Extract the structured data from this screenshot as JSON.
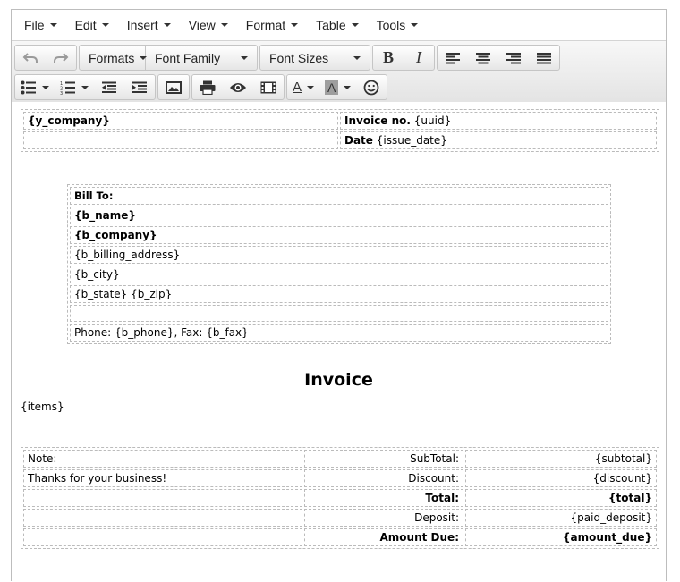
{
  "menu": [
    "File",
    "Edit",
    "Insert",
    "View",
    "Format",
    "Table",
    "Tools"
  ],
  "toolbar": {
    "formats": "Formats",
    "font_family": "Font Family",
    "font_sizes": "Font Sizes",
    "bold": "B",
    "italic": "I",
    "text_color_glyph": "A",
    "bg_color_glyph": "A",
    "bg_color": "#9e9e9e"
  },
  "doc": {
    "company": "{y_company}",
    "invoice_no_label": "Invoice no.",
    "invoice_no_value": " {uuid}",
    "date_label": "Date",
    "date_value": " {issue_date}",
    "bill_to": "Bill To:",
    "b_name": "{b_name}",
    "b_company": "{b_company}",
    "b_billing_address": "{b_billing_address}",
    "b_city": "{b_city}",
    "b_state_zip": "{b_state} {b_zip}",
    "phone_fax": "Phone: {b_phone}, Fax: {b_fax}",
    "title": "Invoice",
    "items": "{items}",
    "note_label": "Note:",
    "thanks": "Thanks for your business!",
    "subtotal_label": "SubTotal:",
    "subtotal_value": "{subtotal}",
    "discount_label": "Discount:",
    "discount_value": "{discount}",
    "total_label": "Total:",
    "total_value": "{total}",
    "deposit_label": "Deposit:",
    "deposit_value": "{paid_deposit}",
    "amount_due_label": "Amount Due:",
    "amount_due_value": "{amount_due}"
  }
}
